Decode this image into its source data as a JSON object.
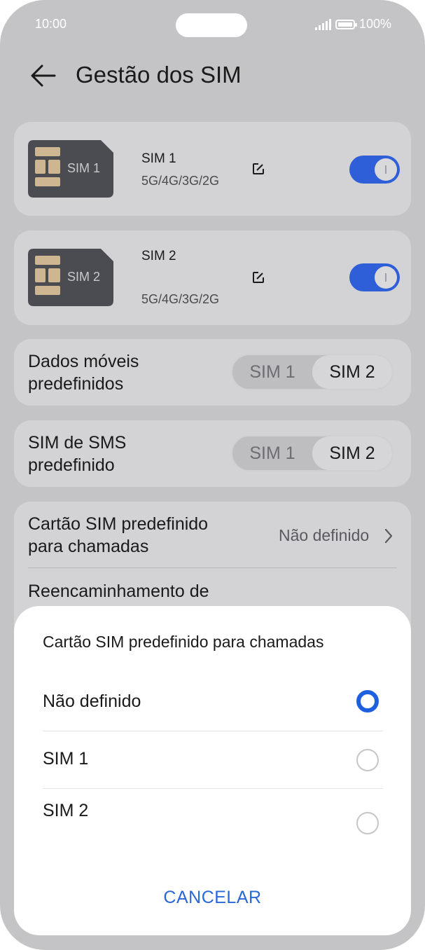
{
  "status_bar": {
    "time": "10:00",
    "battery": "100%"
  },
  "header": {
    "title": "Gestão dos SIM"
  },
  "sims": [
    {
      "card_label": "SIM 1",
      "name": "SIM 1",
      "networks": "5G/4G/3G/2G",
      "enabled": true
    },
    {
      "card_label": "SIM 2",
      "name": "SIM 2",
      "networks": "5G/4G/3G/2G",
      "enabled": true
    }
  ],
  "default_data": {
    "label_line1": "Dados móveis",
    "label_line2": "predefinidos",
    "options": [
      "SIM 1",
      "SIM 2"
    ],
    "selected": "SIM 2"
  },
  "default_sms": {
    "label_line1": "SIM de SMS",
    "label_line2": "predefinido",
    "options": [
      "SIM 1",
      "SIM 2"
    ],
    "selected": "SIM 2"
  },
  "default_calls": {
    "label_line1": "Cartão SIM predefinido",
    "label_line2": "para chamadas",
    "value": "Não definido"
  },
  "forwarding": {
    "label_line1": "Reencaminhamento de"
  },
  "sheet": {
    "title": "Cartão SIM predefinido para chamadas",
    "options": [
      {
        "label": "Não definido",
        "selected": true
      },
      {
        "label": "SIM 1",
        "selected": false
      },
      {
        "label": "SIM 2",
        "selected": false
      }
    ],
    "cancel_label": "CANCELAR"
  },
  "colors": {
    "accent": "#2e5fd8",
    "cancel": "#2a68d8",
    "background_dim": "#c4c4c6"
  }
}
